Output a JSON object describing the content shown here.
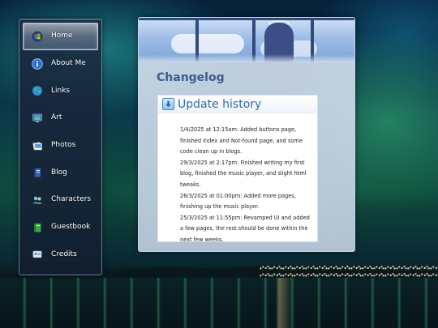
{
  "sidebar": {
    "items": [
      {
        "label": "Home",
        "icon": "windows-home-icon",
        "active": true
      },
      {
        "label": "About Me",
        "icon": "info-icon"
      },
      {
        "label": "Links",
        "icon": "globe-icon"
      },
      {
        "label": "Art",
        "icon": "monitor-art-icon"
      },
      {
        "label": "Photos",
        "icon": "photos-icon"
      },
      {
        "label": "Blog",
        "icon": "blog-book-icon"
      },
      {
        "label": "Characters",
        "icon": "characters-icon"
      },
      {
        "label": "Guestbook",
        "icon": "guestbook-icon"
      },
      {
        "label": "Credits",
        "icon": "credits-icon"
      }
    ]
  },
  "main": {
    "page_title": "Changelog",
    "card": {
      "title": "Update history",
      "entries": [
        "1/4/2025 at 12:15am: Added buttons page, finished Index and Not-found page, and some code clean up in blogs.",
        "29/3/2025 at 2:17pm: Finished writing my first blog, finished the music player, and slight html tweaks.",
        "26/3/2025 at 01:00pm: Added more pages, finishing up the music player.",
        "25/3/2025 at 11:55pm: Revamped UI and added a few pages, the rest should be done within the next few weeks."
      ]
    }
  },
  "colors": {
    "accent": "#2f6bb0",
    "title": "#3a5d8c"
  }
}
